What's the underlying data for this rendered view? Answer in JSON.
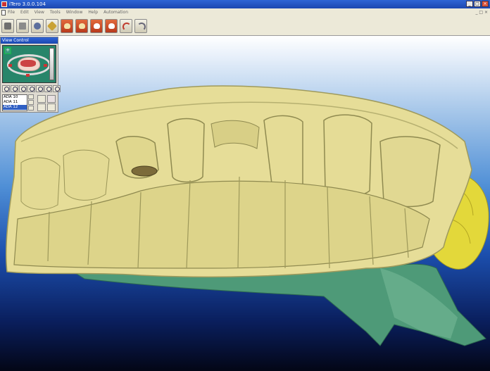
{
  "window": {
    "title": "iTero 3.0.0.104",
    "controls": [
      "_",
      "□",
      "×"
    ]
  },
  "menu": {
    "items": [
      "File",
      "Edit",
      "View",
      "Tools",
      "Window",
      "Help",
      "Automation"
    ],
    "right_control": "_ □ ×"
  },
  "toolbar": {
    "buttons": [
      "open-scan",
      "save",
      "view-3d",
      "measure-tag",
      "tooth-upper",
      "tooth-lower",
      "jaw-both",
      "tooth-single",
      "undo",
      "redo"
    ]
  },
  "view_control": {
    "title": "View Control",
    "plus_label": "+",
    "list": [
      "ADA 10",
      "ADA 11",
      "ADA 12"
    ],
    "selected": "ADA 12"
  },
  "colors": {
    "model": "#e6dd98",
    "model_shadow": "#a39f62",
    "gingiva_base": "#4e9a78",
    "highlight_tooth": "#e3d83a",
    "accent_title": "#2f65d6"
  }
}
